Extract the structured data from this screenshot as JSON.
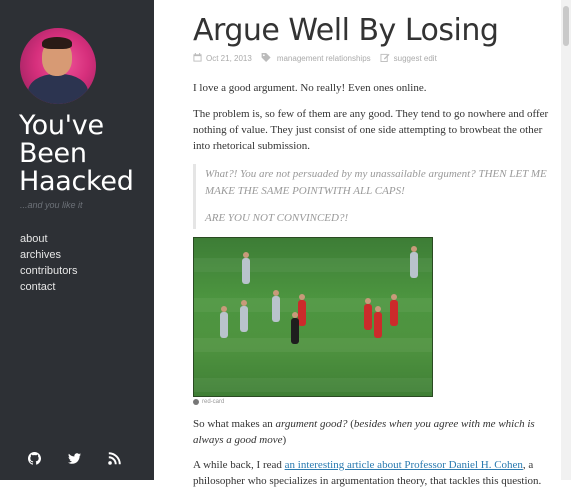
{
  "sidebar": {
    "site_title": "You've Been Haacked",
    "tagline": "...and you like it",
    "nav": [
      {
        "label": "about"
      },
      {
        "label": "archives"
      },
      {
        "label": "contributors"
      },
      {
        "label": "contact"
      }
    ],
    "social_icons": [
      "github-icon",
      "twitter-icon",
      "rss-icon"
    ]
  },
  "post": {
    "title": "Argue Well By Losing",
    "date": "Oct 21, 2013",
    "tags": "management relationships",
    "suggest_edit": "suggest edit",
    "para1": "I love a good argument. No really! Even ones online.",
    "para2": "The problem is, so few of them are any good. They tend to go nowhere and offer nothing of value. They just consist of one side attempting to browbeat the other into rhetorical submission.",
    "quote1": "What?! You are not persuaded by my unassailable argument? THEN LET ME MAKE THE SAME POINTWITH ALL CAPS!",
    "quote2": "ARE YOU NOT CONVINCED?!",
    "image_caption": "red-card",
    "para3_a": "So what makes an ",
    "para3_em1": "argument good?",
    "para3_b": " (",
    "para3_em2": "besides when you agree with me which is always a good move",
    "para3_c": ")",
    "para4_a": "A while back, I read ",
    "para4_link": "an interesting article about Professor Daniel H. Cohen",
    "para4_b": ", a philosopher who specializes in argumentation theory, that tackles this question."
  },
  "colors": {
    "sidebar_bg": "#2d3035",
    "link": "#2a7ab0",
    "quote_text": "#999999"
  }
}
